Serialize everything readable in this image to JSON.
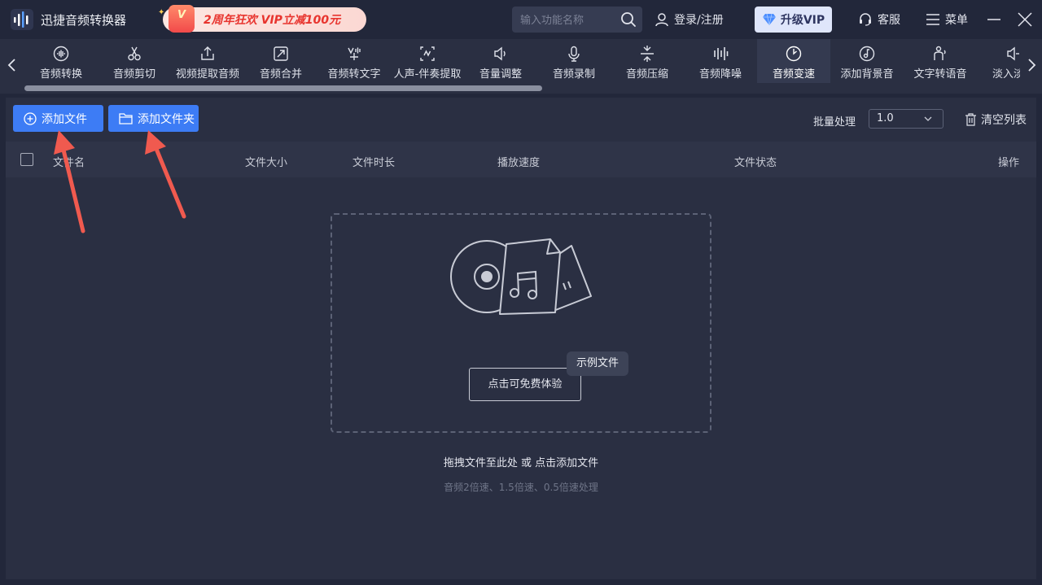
{
  "app": {
    "title": "迅捷音频转换器"
  },
  "promo": {
    "badge": "V",
    "text": "2周年狂欢 VIP立减100元"
  },
  "header": {
    "search_placeholder": "输入功能名称",
    "login_label": "登录/注册",
    "vip_label": "升级VIP",
    "service_label": "客服",
    "menu_label": "菜单"
  },
  "tools": [
    {
      "label": "音频转换",
      "icon": "waveform-circle-icon"
    },
    {
      "label": "音频剪切",
      "icon": "scissors-icon"
    },
    {
      "label": "视频提取音频",
      "icon": "upload-box-icon"
    },
    {
      "label": "音频合并",
      "icon": "merge-arrows-icon"
    },
    {
      "label": "音频转文字",
      "icon": "audio-to-text-icon"
    },
    {
      "label": "人声-伴奏提取",
      "icon": "voice-split-icon"
    },
    {
      "label": "音量调整",
      "icon": "speaker-icon"
    },
    {
      "label": "音频录制",
      "icon": "microphone-icon"
    },
    {
      "label": "音频压缩",
      "icon": "compress-icon"
    },
    {
      "label": "音频降噪",
      "icon": "equalizer-bars-icon"
    },
    {
      "label": "音频变速",
      "icon": "speed-gauge-icon",
      "active": true
    },
    {
      "label": "添加背景音",
      "icon": "music-note-circle-icon"
    },
    {
      "label": "文字转语音",
      "icon": "text-to-speech-icon"
    },
    {
      "label": "淡入淡出",
      "icon": "fade-icon"
    }
  ],
  "toolbar": {
    "add_file_label": "添加文件",
    "add_folder_label": "添加文件夹",
    "batch_label": "批量处理",
    "batch_value": "1.0",
    "clear_label": "清空列表"
  },
  "table": {
    "columns": [
      "文件名",
      "文件大小",
      "文件时长",
      "播放速度",
      "文件状态",
      "操作"
    ]
  },
  "dropzone": {
    "try_label": "点击可免费体验",
    "sample_tag": "示例文件",
    "hint": "拖拽文件至此处 或 点击添加文件",
    "subhint": "音频2倍速、1.5倍速、0.5倍速处理"
  },
  "colors": {
    "accent": "#3d7cf5",
    "background": "#22273a",
    "panel": "#2a2f42",
    "annotation": "#f05a4f"
  }
}
